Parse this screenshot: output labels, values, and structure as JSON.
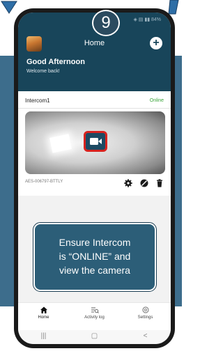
{
  "step": {
    "number": "9"
  },
  "status_bar": {
    "icons_text": "◈ ▤ ▮▮ 84%"
  },
  "header": {
    "title": "Home",
    "greeting": "Good Afternoon",
    "subtext": "Welcome back!"
  },
  "device": {
    "name": "Intercom1",
    "status": "Online",
    "id": "AES-006797-BTTLY"
  },
  "callout": {
    "lines": [
      "Ensure Intercom",
      "is “ONLINE” and",
      "view the camera"
    ]
  },
  "tabs": [
    {
      "label": "Home",
      "icon": "home-icon",
      "active": true
    },
    {
      "label": "Activity log",
      "icon": "activity-log-icon",
      "active": false
    },
    {
      "label": "Settings",
      "icon": "settings-icon",
      "active": false
    }
  ],
  "nav": {
    "recents": "|||",
    "home": "▢",
    "back": "<"
  },
  "colors": {
    "header_bg": "#18455a",
    "online": "#3aa53a",
    "highlight": "#d8231f",
    "callout_bg": "#2c5e78",
    "side_panel": "#3d6d8c"
  }
}
